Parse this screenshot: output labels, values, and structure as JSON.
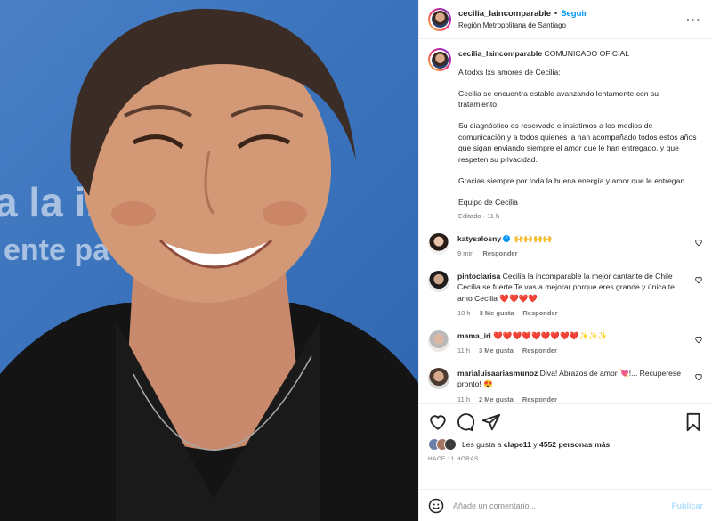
{
  "header": {
    "username": "cecilia_laincomparable",
    "separator": "•",
    "follow_label": "Seguir",
    "location": "Región Metropolitana de Santiago",
    "more_label": "···"
  },
  "photo": {
    "backdrop_text_1": "a la in",
    "backdrop_text_2": "ente pa"
  },
  "caption": {
    "username": "cecilia_laincomparable",
    "title": "COMUNICADO OFICIAL",
    "paragraphs": [
      "A todxs lxs amores de Cecilia:",
      "Cecilia se encuentra estable avanzando lentamente con su tratamiento.",
      "Su diagnóstico es reservado e insistimos a los medios de comunicación y a todos quienes la han acompañado todos estos años que sigan enviando siempre el amor que le han entregado, y que respeten su privacidad.",
      "Gracias siempre por toda la buena energía y amor que le entregan.",
      "Equipo de Cecilia"
    ],
    "meta": "Editado · 11 h"
  },
  "comments": [
    {
      "username": "katysalosny",
      "verified": true,
      "text": "🙌🙌🙌🙌",
      "time": "9 min",
      "likes": "",
      "reply": "Responder"
    },
    {
      "username": "pintoclarisa",
      "verified": false,
      "text": "Cecilia la incomparable la mejor cantante de Chile Cecilia se fuerte Te vas a mejorar porque eres grande y única te amo Cecilia ❤️❤️❤️❤️",
      "time": "10 h",
      "likes": "3 Me gusta",
      "reply": "Responder"
    },
    {
      "username": "mama_iri",
      "verified": false,
      "text": "❤️❤️❤️❤️❤️❤️❤️❤️❤️✨✨✨",
      "time": "11 h",
      "likes": "3 Me gusta",
      "reply": "Responder"
    },
    {
      "username": "marialuisaariasmunoz",
      "verified": false,
      "text": "Diva! Abrazos de amor 💘!... Recuperese pronto! 😍",
      "time": "11 h",
      "likes": "2 Me gusta",
      "reply": "Responder"
    }
  ],
  "likes": {
    "prefix": "Les gusta a",
    "user": "clape11",
    "middle": "y",
    "count": "4552 personas más"
  },
  "posted_ago": "HACE 11 HORAS",
  "add_comment": {
    "placeholder": "Añade un comentario...",
    "publish_label": "Publicar"
  },
  "icons": {
    "like": "heart-icon",
    "comment": "comment-icon",
    "share": "share-icon",
    "save": "bookmark-icon",
    "emoji": "emoji-icon"
  },
  "colors": {
    "accent": "#0095f6",
    "publish_disabled": "#b2dffc",
    "photo_background": "#3b74bd"
  }
}
